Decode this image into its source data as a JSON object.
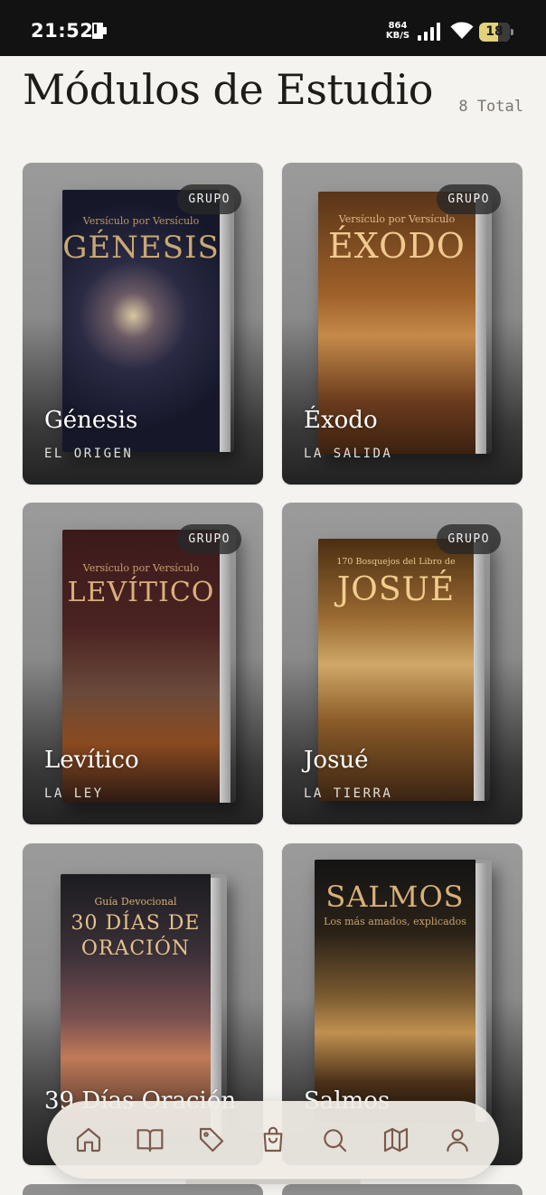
{
  "status_bar": {
    "time": "21:52",
    "net_speed_value": "864",
    "net_speed_unit": "KB/S",
    "battery": "18"
  },
  "header": {
    "title": "Módulos de Estudio",
    "total": "8 Total"
  },
  "modules": [
    {
      "title": "Génesis",
      "subtitle": "EL ORIGEN",
      "badge": "GRUPO",
      "cover_kicker": "Versículo por Versículo",
      "cover_title": "GÉNESIS"
    },
    {
      "title": "Éxodo",
      "subtitle": "LA SALIDA",
      "badge": "GRUPO",
      "cover_kicker": "Versículo por Versículo",
      "cover_title": "ÉXODO"
    },
    {
      "title": "Levítico",
      "subtitle": "LA LEY",
      "badge": "GRUPO",
      "cover_kicker": "Versículo por Versículo",
      "cover_title": "LEVÍTICO"
    },
    {
      "title": "Josué",
      "subtitle": "LA TIERRA",
      "badge": "GRUPO",
      "cover_kicker": "170 Bosquejos del Libro de",
      "cover_title": "JOSUÉ"
    },
    {
      "title": "39 Días Oración",
      "subtitle": "",
      "badge": "",
      "cover_kicker": "Guía Devocional",
      "cover_title": "30 DÍAS DE",
      "cover_title2": "ORACIÓN"
    },
    {
      "title": "Salmos",
      "subtitle": "",
      "badge": "",
      "cover_kicker": "Los más amados, explicados",
      "cover_title": "SALMOS"
    }
  ],
  "nav": [
    {
      "icon": "home-icon"
    },
    {
      "icon": "book-open-icon"
    },
    {
      "icon": "tag-icon"
    },
    {
      "icon": "shopping-bag-icon"
    },
    {
      "icon": "search-icon"
    },
    {
      "icon": "map-icon"
    },
    {
      "icon": "user-icon"
    }
  ],
  "colors": {
    "background": "#f5f3ef",
    "nav_icon": "#7a5a4a",
    "title_text": "#1f1b18"
  }
}
